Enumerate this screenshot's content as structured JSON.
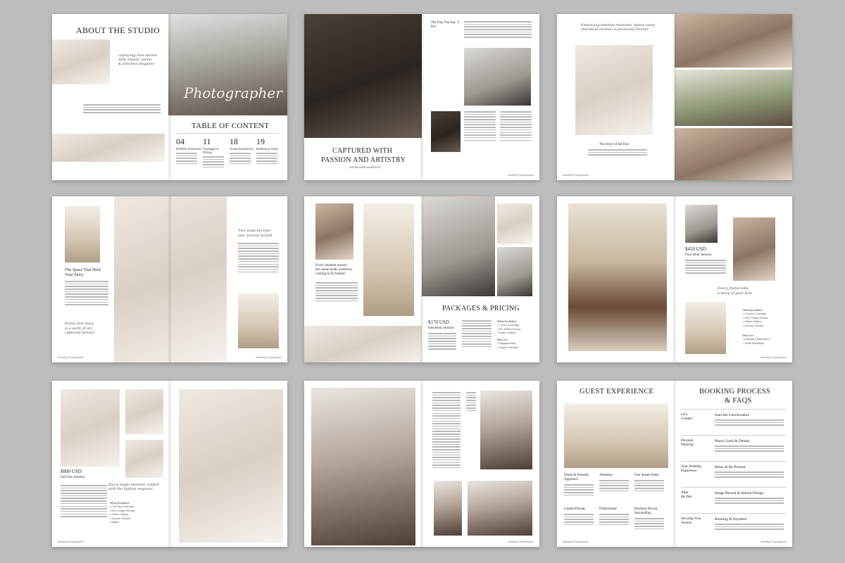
{
  "spread1": {
    "heading": "ABOUT THE STUDIO",
    "script_caption": "capturing love stories\nwith artistic vision\n& timeless elegance",
    "photographer_script": "Photographer",
    "toc_heading": "TABLE OF CONTENT",
    "toc": [
      {
        "num": "04",
        "label": "Portfolio Showcase"
      },
      {
        "num": "11",
        "label": "Packages & Pricing"
      },
      {
        "num": "18",
        "label": "Guest Experience"
      },
      {
        "num": "19",
        "label": "Booking & FAQs"
      }
    ]
  },
  "spread2": {
    "quote_title": "The Day You Say \"I Do\"",
    "heading_line1": "CAPTURED WITH",
    "heading_line2": "PASSION AND ARTISTRY",
    "subheading": "SHOWCASE MOMENTS",
    "footer_right": "Wedding Photographer"
  },
  "spread3": {
    "script_caption": "Embracing timeless moments, where every\ncherished emotion is preserved forever",
    "story_title": "The Story of the Day",
    "footer_left": "Wedding Photographer"
  },
  "spread4": {
    "space_title": "The Space That Held\nYour Story",
    "script_top": "Two souls become\none, forever bound",
    "script_bottom": "Every love story\nis a work of art,\ncaptured forever",
    "footer_left": "Wedding Photographer",
    "footer_right": "Wedding Photographer"
  },
  "spread5": {
    "intro": "Every moment around\nthe venue holds a memory\nwaiting to be framed",
    "heading": "PACKAGES & PRICING",
    "price": "$170 USD",
    "session": "One Hour Session",
    "included_title": "What Included:",
    "included": [
      "1 Hour Coverage",
      "50+ Edited Photos",
      "Online Gallery"
    ],
    "best_title": "Best for:",
    "best": [
      "Engagements",
      "Couple Portraits"
    ]
  },
  "spread6": {
    "price": "$450 USD",
    "session": "Four Hour Session",
    "script_caption": "Every frame tells\na story of your love",
    "included_title": "What Included:",
    "included": [
      "4 Hours Coverage",
      "200+ Edited Photos",
      "Online Gallery",
      "Second Shooter"
    ],
    "best_title": "Best for:",
    "best": [
      "Intimate Ceremonies",
      "Small Weddings"
    ],
    "footer_right": "Wedding Photographer"
  },
  "spread7": {
    "price": "$800 USD",
    "session": "Full Day Session",
    "script_caption": "Every single moment, crafted\nwith the highest elegance",
    "included_title": "What Included:",
    "included": [
      "Full Day Coverage",
      "500+ Edited Photos",
      "Online Gallery",
      "Second Shooter",
      "Album"
    ],
    "footer_left": "Wedding Photographer"
  },
  "spread8": {
    "footer_right": "Wedding Photographer"
  },
  "spread9": {
    "guest_heading": "GUEST EXPERIENCE",
    "booking_heading_line1": "BOOKING PROCESS",
    "booking_heading_line2": "& FAQS",
    "features": [
      {
        "label": "Warm & Friendly\nApproach"
      },
      {
        "label": "Attention"
      },
      {
        "label": "Fast Sneak Peeks"
      },
      {
        "label": "Guided Posing"
      },
      {
        "label": "Professional"
      },
      {
        "label": "Emotion Driven\nStorytelling"
      }
    ],
    "steps": [
      {
        "label": "Let's\nConnect",
        "title": "Start the Conversation"
      },
      {
        "label": "Personal\nPlanning",
        "title": "Photo Goals & Details"
      },
      {
        "label": "Your Wedding\nExperience",
        "title": "Relax & Be Present"
      },
      {
        "label": "After\nthe Day",
        "title": "Image Reveal & Album Design"
      },
      {
        "label": "Securing Your\nSession",
        "title": "Booking & Payment"
      }
    ],
    "footer_left": "Wedding Photographer",
    "footer_right": "Wedding Photographer"
  }
}
